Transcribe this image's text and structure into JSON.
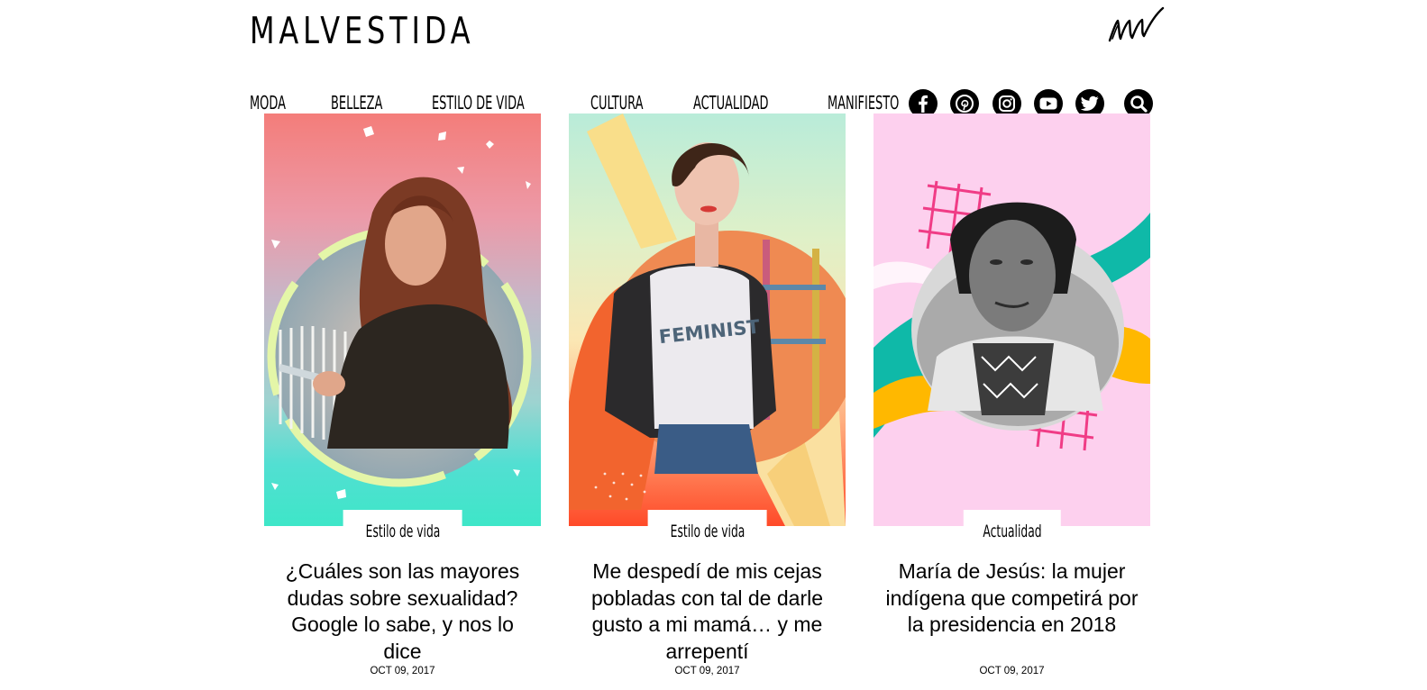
{
  "header": {
    "logo_text": "MALVESTIDA",
    "monogram": "mw-monogram-icon"
  },
  "nav": {
    "items": [
      {
        "label": "MODA"
      },
      {
        "label": "BELLEZA"
      },
      {
        "label": "ESTILO DE VIDA"
      },
      {
        "label": "CULTURA"
      },
      {
        "label": "ACTUALIDAD"
      },
      {
        "label": "MANIFIESTO"
      }
    ]
  },
  "social": {
    "icons": [
      "facebook-icon",
      "pinterest-icon",
      "instagram-icon",
      "youtube-icon",
      "twitter-icon",
      "search-icon"
    ]
  },
  "articles": [
    {
      "category": "Estilo de vida",
      "title": "¿Cuáles son las mayores dudas sobre sexualidad? Google lo sabe, y nos lo dice",
      "date": "OCT 09, 2017"
    },
    {
      "category": "Estilo de vida",
      "title": "Me despedí de mis cejas pobladas con tal de darle gusto a mi mamá… y me arrepentí",
      "date": "OCT 09, 2017"
    },
    {
      "category": "Actualidad",
      "title": "María de Jesús: la mujer indígena que competirá por la presidencia en 2018",
      "date": "OCT 09, 2017"
    }
  ],
  "colors": {
    "text": "#000000",
    "background": "#ffffff",
    "card1_top": "#f07f7f",
    "card1_bottom": "#3fe0d0",
    "card2_top": "#bdebd9",
    "card2_bottom": "#ff4d2a",
    "card3_bg": "#fdd0ee"
  }
}
